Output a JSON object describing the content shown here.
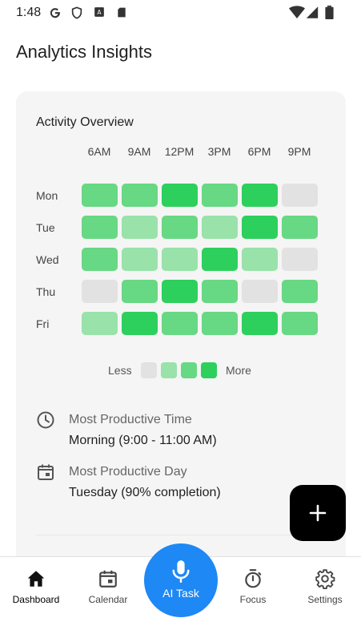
{
  "status_bar": {
    "time": "1:48",
    "left_icons": [
      "google-icon",
      "shield-icon",
      "news-icon",
      "sd-card-icon"
    ],
    "right_icons": [
      "wifi-icon",
      "signal-icon",
      "battery-icon"
    ]
  },
  "page": {
    "title": "Analytics Insights"
  },
  "activity": {
    "title": "Activity Overview",
    "time_labels": [
      "6AM",
      "9AM",
      "12PM",
      "3PM",
      "6PM",
      "9PM"
    ],
    "days": [
      "Mon",
      "Tue",
      "Wed",
      "Thu",
      "Fri"
    ],
    "levels_note": "0=none,1=low,2=medium,3=high",
    "levels": [
      [
        2,
        2,
        3,
        2,
        3,
        0
      ],
      [
        2,
        1,
        2,
        1,
        3,
        2
      ],
      [
        2,
        1,
        1,
        3,
        1,
        0
      ],
      [
        0,
        2,
        3,
        2,
        0,
        2
      ],
      [
        1,
        3,
        2,
        2,
        3,
        2
      ]
    ],
    "level_colors": [
      "#e2e2e2",
      "#99e2a9",
      "#67d883",
      "#2dd05c"
    ],
    "legend": {
      "less": "Less",
      "more": "More"
    }
  },
  "insights": [
    {
      "icon": "clock-icon",
      "label": "Most Productive Time",
      "value": "Morning (9:00 - 11:00 AM)"
    },
    {
      "icon": "calendar-icon",
      "label": "Most Productive Day",
      "value": "Tuesday (90% completion)"
    }
  ],
  "fab": {
    "icon": "plus-icon"
  },
  "nav": {
    "items": [
      {
        "label": "Dashboard",
        "icon": "home-icon",
        "active": true
      },
      {
        "label": "Calendar",
        "icon": "calendar-icon",
        "active": false
      },
      {
        "label": "Focus",
        "icon": "timer-icon",
        "active": false
      },
      {
        "label": "Settings",
        "icon": "gear-icon",
        "active": false
      }
    ],
    "ai": {
      "label": "AI Task",
      "icon": "microphone-icon"
    }
  },
  "colors": {
    "accent": "#1e88f5",
    "card": "#f5f5f5",
    "fab": "#000000"
  }
}
